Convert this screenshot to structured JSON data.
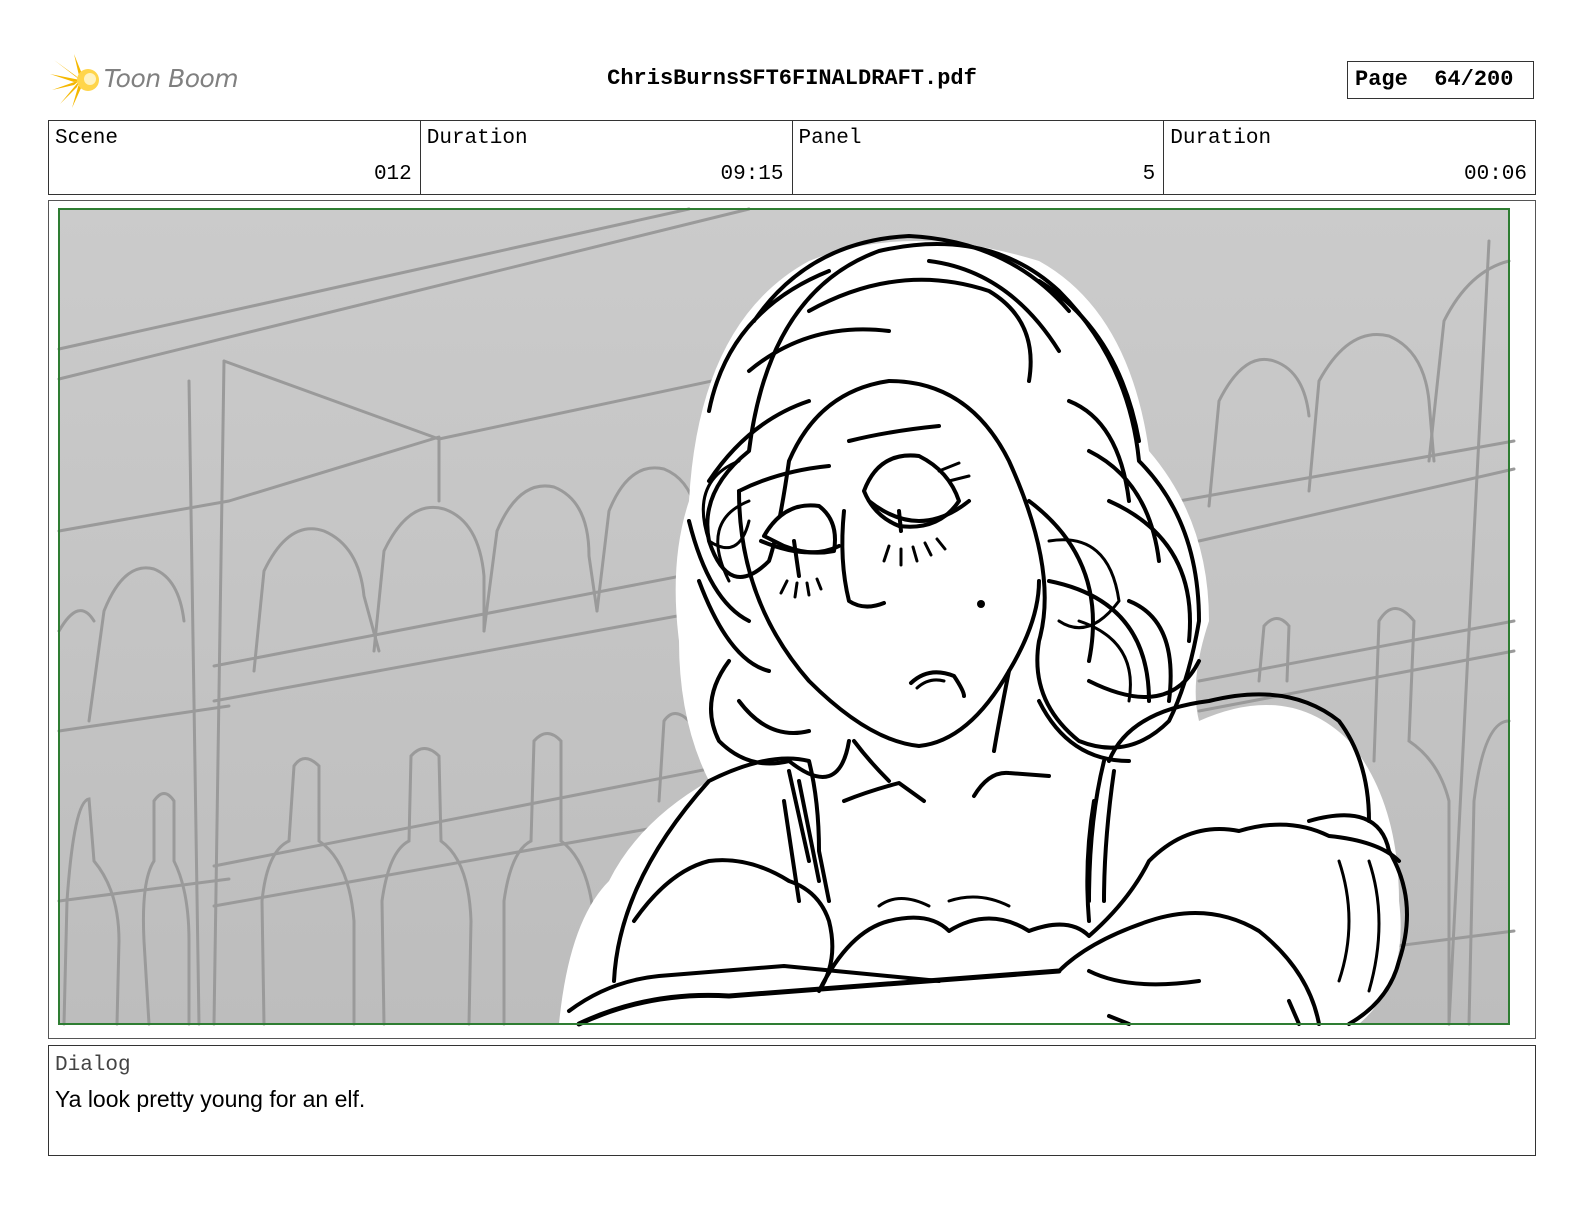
{
  "header": {
    "logo_text": "Toon Boom",
    "document_title": "ChrisBurnsSFT6FINALDRAFT.pdf",
    "page_label": "Page",
    "page_number": "64/200"
  },
  "info": {
    "scene_label": "Scene",
    "scene_value": "012",
    "scene_duration_label": "Duration",
    "scene_duration_value": "09:15",
    "panel_label": "Panel",
    "panel_value": "5",
    "panel_duration_label": "Duration",
    "panel_duration_value": "00:06"
  },
  "panel": {
    "background_color": "#c4c4c4",
    "frame_color": "#2e7d32",
    "line_color": "#9a9a9a"
  },
  "dialog": {
    "label": "Dialog",
    "text": "Ya look pretty young for an elf."
  }
}
